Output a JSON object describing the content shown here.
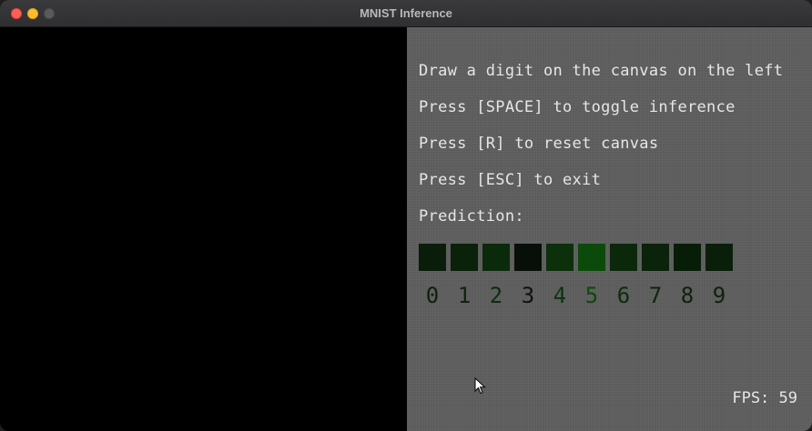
{
  "window": {
    "title": "MNIST Inference"
  },
  "panel": {
    "instructions": [
      "Draw a digit on the canvas on the left",
      "Press [SPACE] to toggle inference",
      "Press [R] to reset canvas",
      "Press [ESC] to exit",
      "Prediction:"
    ],
    "predictions": [
      {
        "digit": "0",
        "color": "#0a1c0a",
        "text_color": "#0f1f0f"
      },
      {
        "digit": "1",
        "color": "#0a210a",
        "text_color": "#0f240f"
      },
      {
        "digit": "2",
        "color": "#0b2a0b",
        "text_color": "#0e2c0e"
      },
      {
        "digit": "3",
        "color": "#080f08",
        "text_color": "#0d130d"
      },
      {
        "digit": "4",
        "color": "#0c2f0c",
        "text_color": "#0f320f"
      },
      {
        "digit": "5",
        "color": "#0b4a0b",
        "text_color": "#0b4a0b"
      },
      {
        "digit": "6",
        "color": "#0b280b",
        "text_color": "#0e2c0e"
      },
      {
        "digit": "7",
        "color": "#0a230a",
        "text_color": "#0e260e"
      },
      {
        "digit": "8",
        "color": "#081d08",
        "text_color": "#0e210e"
      },
      {
        "digit": "9",
        "color": "#0a1f0a",
        "text_color": "#0e220e"
      }
    ],
    "fps": "FPS: 59"
  },
  "cursor": {
    "icon": "arrow-cursor-icon"
  }
}
